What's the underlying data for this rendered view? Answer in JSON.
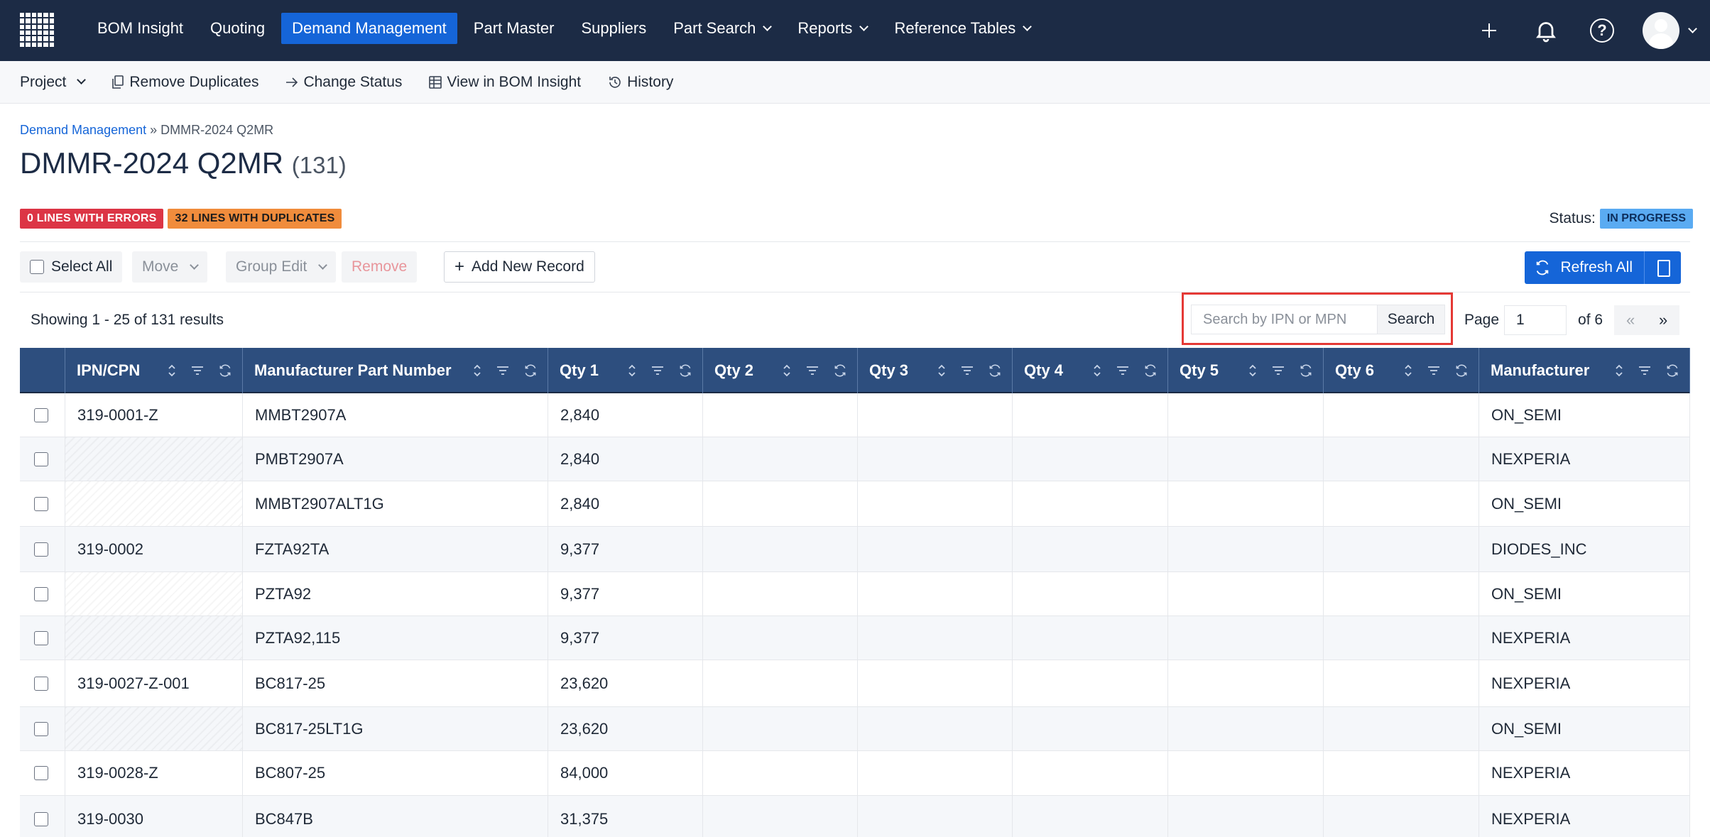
{
  "nav": {
    "items": [
      {
        "label": "BOM Insight",
        "dropdown": false,
        "active": false
      },
      {
        "label": "Quoting",
        "dropdown": false,
        "active": false
      },
      {
        "label": "Demand Management",
        "dropdown": false,
        "active": true
      },
      {
        "label": "Part Master",
        "dropdown": false,
        "active": false
      },
      {
        "label": "Suppliers",
        "dropdown": false,
        "active": false
      },
      {
        "label": "Part Search",
        "dropdown": true,
        "active": false
      },
      {
        "label": "Reports",
        "dropdown": true,
        "active": false
      },
      {
        "label": "Reference Tables",
        "dropdown": true,
        "active": false
      }
    ],
    "colors": {
      "bar": "#1c2b45",
      "active": "#1565d8"
    }
  },
  "subbar": {
    "project": "Project",
    "remove_duplicates": "Remove Duplicates",
    "change_status": "Change Status",
    "view_bom": "View in BOM Insight",
    "history": "History"
  },
  "breadcrumb": {
    "parent": "Demand Management",
    "separator": "»",
    "current": "DMMR-2024 Q2MR"
  },
  "page": {
    "title": "DMMR-2024 Q2MR",
    "count": "(131)"
  },
  "badges": {
    "errors": "0 LINES WITH ERRORS",
    "duplicates": "32 LINES WITH DUPLICATES"
  },
  "status": {
    "label": "Status:",
    "value": "IN PROGRESS"
  },
  "actions": {
    "select_all": "Select All",
    "move": "Move",
    "group_edit": "Group Edit",
    "remove": "Remove",
    "add_new": "Add New Record",
    "refresh_all": "Refresh All"
  },
  "results": {
    "showing": "Showing 1 - 25 of 131 results",
    "search_placeholder": "Search by IPN or MPN",
    "search_button": "Search",
    "page_label": "Page",
    "page_value": "1",
    "of_label": "of 6",
    "prev": "«",
    "next": "»"
  },
  "table": {
    "columns": [
      "IPN/CPN",
      "Manufacturer Part Number",
      "Qty 1",
      "Qty 2",
      "Qty 3",
      "Qty 4",
      "Qty 5",
      "Qty 6",
      "Manufacturer"
    ],
    "rows": [
      {
        "ipn": "319-0001-Z",
        "mpn": "MMBT2907A",
        "qty1": "2,840",
        "mfr": "ON_SEMI"
      },
      {
        "ipn": "",
        "mpn": "PMBT2907A",
        "qty1": "2,840",
        "mfr": "NEXPERIA"
      },
      {
        "ipn": "",
        "mpn": "MMBT2907ALT1G",
        "qty1": "2,840",
        "mfr": "ON_SEMI"
      },
      {
        "ipn": "319-0002",
        "mpn": "FZTA92TA",
        "qty1": "9,377",
        "mfr": "DIODES_INC"
      },
      {
        "ipn": "",
        "mpn": "PZTA92",
        "qty1": "9,377",
        "mfr": "ON_SEMI"
      },
      {
        "ipn": "",
        "mpn": "PZTA92,115",
        "qty1": "9,377",
        "mfr": "NEXPERIA"
      },
      {
        "ipn": "319-0027-Z-001",
        "mpn": "BC817-25",
        "qty1": "23,620",
        "mfr": "NEXPERIA"
      },
      {
        "ipn": "",
        "mpn": "BC817-25LT1G",
        "qty1": "23,620",
        "mfr": "ON_SEMI"
      },
      {
        "ipn": "319-0028-Z",
        "mpn": "BC807-25",
        "qty1": "84,000",
        "mfr": "NEXPERIA"
      },
      {
        "ipn": "319-0030",
        "mpn": "BC847B",
        "qty1": "31,375",
        "mfr": "NEXPERIA"
      }
    ]
  }
}
